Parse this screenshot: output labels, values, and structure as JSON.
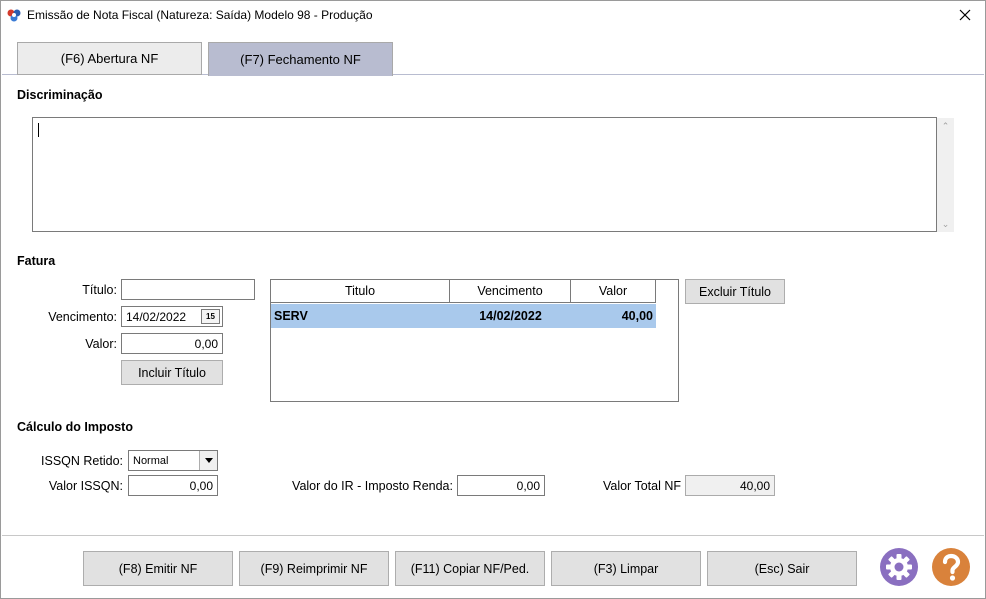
{
  "window": {
    "title": "Emissão de Nota Fiscal (Natureza: Saída) Modelo 98 - Produção"
  },
  "tabs": [
    {
      "label": "(F6) Abertura NF"
    },
    {
      "label": "(F7) Fechamento NF"
    }
  ],
  "discriminacao": {
    "label": "Discriminação",
    "value": ""
  },
  "fatura": {
    "label": "Fatura",
    "titulo_label": "Título:",
    "titulo_value": "",
    "vencimento_label": "Vencimento:",
    "vencimento_value": "14/02/2022",
    "calendar_badge": "15",
    "valor_label": "Valor:",
    "valor_value": "0,00",
    "incluir_button": "Incluir Título",
    "excluir_button": "Excluir Título",
    "grid": {
      "columns": [
        "Titulo",
        "Vencimento",
        "Valor"
      ],
      "rows": [
        {
          "titulo": "SERV",
          "vencimento": "14/02/2022",
          "valor": "40,00"
        }
      ]
    }
  },
  "calculo": {
    "label": "Cálculo do Imposto",
    "issqn_retido_label": "ISSQN Retido:",
    "issqn_retido_value": "Normal",
    "valor_issqn_label": "Valor ISSQN:",
    "valor_issqn_value": "0,00",
    "valor_ir_label": "Valor do IR - Imposto Renda:",
    "valor_ir_value": "0,00",
    "valor_total_label": "Valor Total NF",
    "valor_total_value": "40,00"
  },
  "footer": {
    "emitir": "(F8) Emitir NF",
    "reimprimir": "(F9) Reimprimir NF",
    "copiar": "(F11) Copiar NF/Ped.",
    "limpar": "(F3) Limpar",
    "sair": "(Esc) Sair"
  },
  "icons": {
    "app": "app-logo-icon",
    "close": "close-icon",
    "settings": "gear-icon",
    "help": "help-icon"
  },
  "colors": {
    "tab_active": "#b8bcd0",
    "selected_row": "#a9c9ec",
    "settings_icon": "#8a6fc0",
    "help_icon": "#d9823b"
  }
}
